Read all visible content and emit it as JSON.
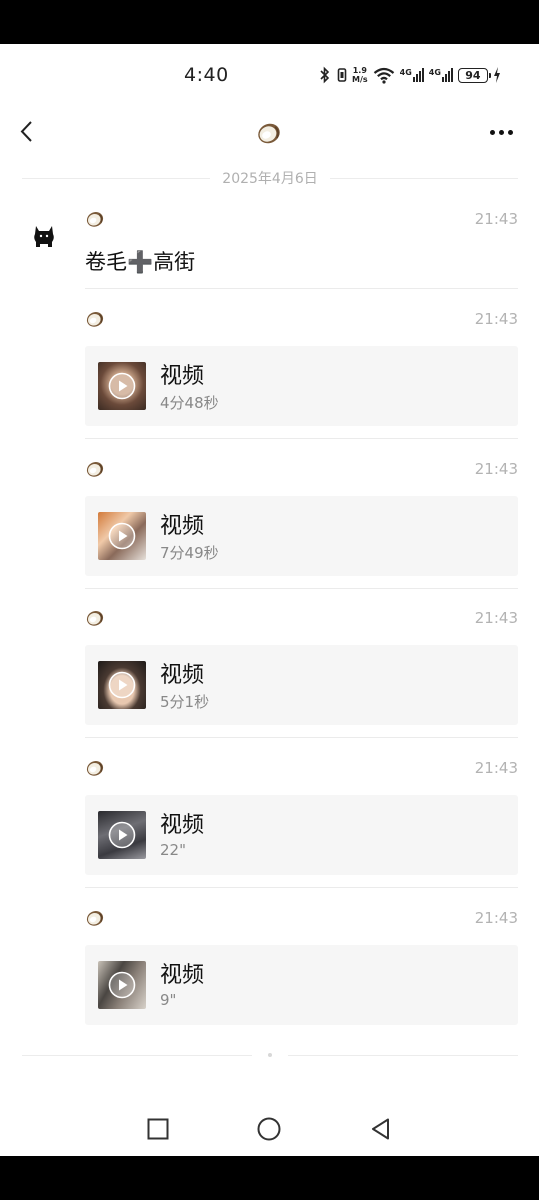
{
  "status_bar": {
    "time": "4:40",
    "net_speed_value": "1.9",
    "net_speed_unit": "M/s",
    "network_1": "4G",
    "network_2": "4G",
    "battery": "94"
  },
  "header": {
    "back_icon": "chevron-left-icon",
    "title_icon": "coconut-icon",
    "more_icon": "more-dots-icon"
  },
  "date_separator": "2025年4月6日",
  "messages": [
    {
      "time": "21:43",
      "type": "text",
      "text": "卷毛➕高街"
    },
    {
      "time": "21:43",
      "type": "video",
      "title": "视频",
      "duration": "4分48秒"
    },
    {
      "time": "21:43",
      "type": "video",
      "title": "视频",
      "duration": "7分49秒"
    },
    {
      "time": "21:43",
      "type": "video",
      "title": "视频",
      "duration": "5分1秒"
    },
    {
      "time": "21:43",
      "type": "video",
      "title": "视频",
      "duration": "22\""
    },
    {
      "time": "21:43",
      "type": "video",
      "title": "视频",
      "duration": "9\""
    }
  ],
  "system_nav": [
    "recents-square-icon",
    "home-circle-icon",
    "back-triangle-icon"
  ]
}
